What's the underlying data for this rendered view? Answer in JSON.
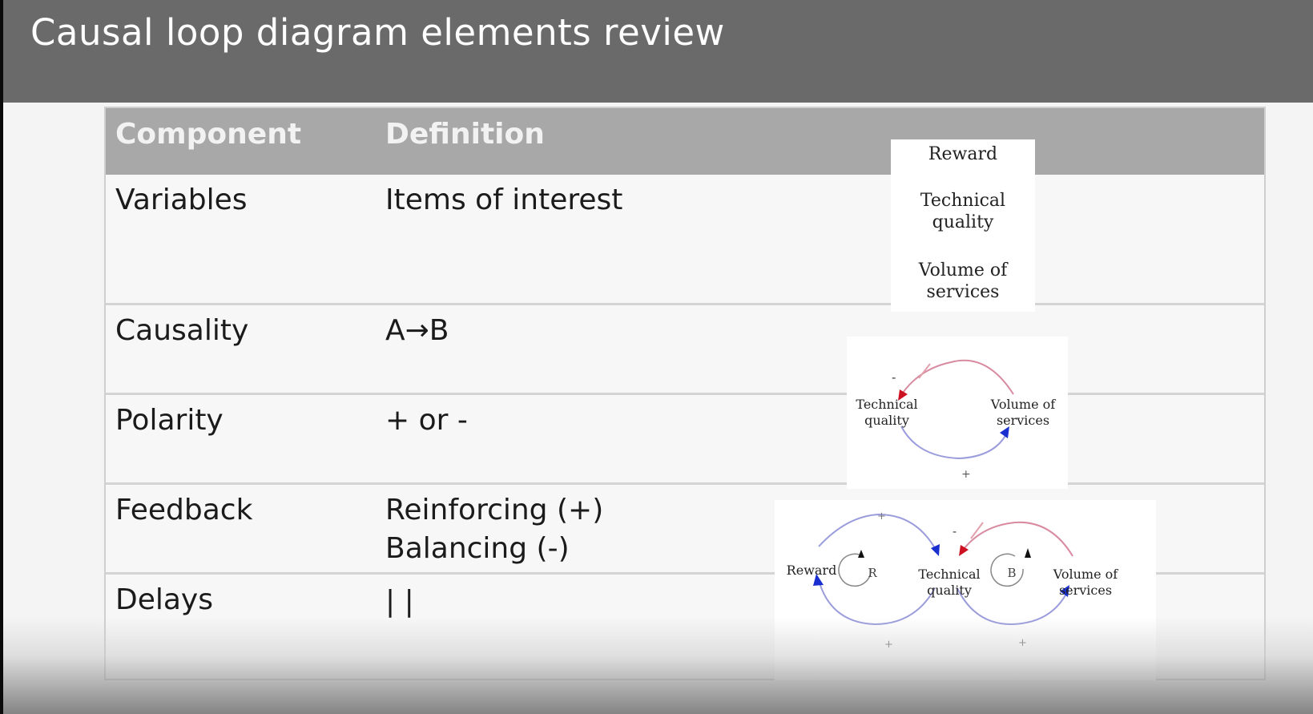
{
  "slide": {
    "title": "Causal loop diagram elements review"
  },
  "table": {
    "headers": [
      "Component",
      "Definition"
    ],
    "rows": [
      {
        "component": "Variables",
        "definition": [
          "Items of interest"
        ]
      },
      {
        "component": "Causality",
        "definition": [
          "A→B"
        ]
      },
      {
        "component": "Polarity",
        "definition": [
          "+ or -"
        ]
      },
      {
        "component": "Feedback",
        "definition": [
          "Reinforcing (+)",
          "Balancing (-)"
        ]
      },
      {
        "component": "Delays",
        "definition": [
          "| |"
        ]
      }
    ]
  },
  "variables_box": {
    "items": [
      "Reward",
      "Technical quality",
      "Volume of services"
    ],
    "lines": [
      "Reward",
      "Technical",
      "quality",
      "Volume of",
      "services"
    ]
  },
  "causality_diagram": {
    "left_label": [
      "Technical",
      "quality"
    ],
    "right_label": [
      "Volume of",
      "services"
    ],
    "top_sign": "-",
    "bottom_sign": "+",
    "top_color": "#cc1122",
    "bottom_color": "#1a2fd0"
  },
  "feedback_diagram": {
    "labels": {
      "reward": "Reward",
      "technical": [
        "Technical",
        "quality"
      ],
      "volume": [
        "Volume of",
        "services"
      ]
    },
    "loop_symbols": [
      "R",
      "B"
    ],
    "signs": {
      "top_left": "+",
      "top_right": "-",
      "bottom_left": "+",
      "bottom_right": "+"
    }
  }
}
